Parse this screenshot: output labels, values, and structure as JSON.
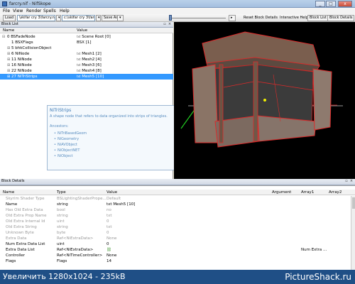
{
  "window": {
    "title": "farcry.nif - NifSkope",
    "minimize": "_",
    "maximize": "□",
    "close": "x"
  },
  "menu": [
    "File",
    "View",
    "Render",
    "Spells",
    "Help"
  ],
  "toolbar": {
    "load": "Load",
    "load_path": "\\skifar cry 3\\farcry.nif",
    "save_path": "c:\\skifar cry 3\\farcry.nif",
    "save_as": "Save As",
    "reset_block_details": "Reset Block Details",
    "interactive_help": "Interactive Help",
    "block_list": "Block List",
    "block_details": "Block Details"
  },
  "block_list": {
    "panel_title": "Block List",
    "col_name": "Name",
    "col_value": "Value",
    "rows": [
      {
        "exp": "⊟",
        "name": "0 BSFadeNode",
        "icon": "txt",
        "value": "Scene Root [0]"
      },
      {
        "exp": "",
        "name": "1 BSXFlags",
        "icon": "",
        "value": "BSX [1]"
      },
      {
        "exp": "⊞",
        "name": "5 bhkCollisionObject",
        "icon": "",
        "value": ""
      },
      {
        "exp": "⊞",
        "name": "6 NiNode",
        "icon": "txt",
        "value": "Mesh1 [2]"
      },
      {
        "exp": "⊞",
        "name": "11 NiNode",
        "icon": "txt",
        "value": "Mesh2 [4]"
      },
      {
        "exp": "⊞",
        "name": "16 NiNode",
        "icon": "txt",
        "value": "Mesh3 [6]"
      },
      {
        "exp": "⊞",
        "name": "22 NiNode",
        "icon": "txt",
        "value": "Mesh4 [8]"
      },
      {
        "exp": "⊞",
        "name": "27 NiTriStrips",
        "icon": "txt",
        "value": "Mesh5 [10]"
      }
    ]
  },
  "tooltip": {
    "title": "NiTriStrips",
    "description": "A shape node that refers to data organized into strips of triangles.",
    "ancestors_label": "Ancestors:",
    "ancestors": [
      "NiTriBasedGeom",
      "NiGeometry",
      "NiAVObject",
      "NiObjectNET",
      "NiObject"
    ]
  },
  "block_details": {
    "panel_title": "Block Details",
    "columns": {
      "name": "Name",
      "type": "Type",
      "value": "Value",
      "argument": "Argument",
      "array1": "Array1",
      "array2": "Array2"
    },
    "rows": [
      {
        "name": "Skyrim Shader Type",
        "type": "BSLightingShaderPrope...",
        "value": "Default",
        "extra": "",
        "dim": true
      },
      {
        "name": "Name",
        "type": "string",
        "value": "txt Mesh5 [10]",
        "extra": "",
        "dim": false
      },
      {
        "name": "Has Old Extra Data",
        "type": "bool",
        "value": "no",
        "extra": "",
        "dim": true
      },
      {
        "name": "Old Extra Prop Name",
        "type": "string",
        "value": "txt",
        "extra": "",
        "dim": true
      },
      {
        "name": "Old Extra Internal Id",
        "type": "uint",
        "value": "0",
        "extra": "",
        "dim": true
      },
      {
        "name": "Old Extra String",
        "type": "string",
        "value": "txt",
        "extra": "",
        "dim": true
      },
      {
        "name": "Unknown Byte",
        "type": "byte",
        "value": "0",
        "extra": "",
        "dim": true
      },
      {
        "name": "Extra Data",
        "type": "Ref<NiExtraData>",
        "value": "None",
        "extra": "",
        "dim": true
      },
      {
        "name": "Num Extra Data List",
        "type": "uint",
        "value": "0",
        "extra": "",
        "dim": false
      },
      {
        "name": "Extra Data List",
        "type": "Ref<NiExtraData>",
        "value": "",
        "extra": "Num Extra ...",
        "dim": false
      },
      {
        "name": "Controller",
        "type": "Ref<NiTimeController>",
        "value": "None",
        "extra": "",
        "dim": false
      },
      {
        "name": "Flags",
        "type": "Flags",
        "value": "14",
        "extra": "",
        "dim": false
      }
    ]
  },
  "banner": {
    "zoom_text": "Увеличить 1280x1024 - 235kB",
    "site": "PictureShack.ru"
  },
  "colors": {
    "selection": "#3399ff",
    "tooltip_text": "#5a8ec0",
    "banner": "#1f4f86",
    "viewport": "#000000"
  }
}
